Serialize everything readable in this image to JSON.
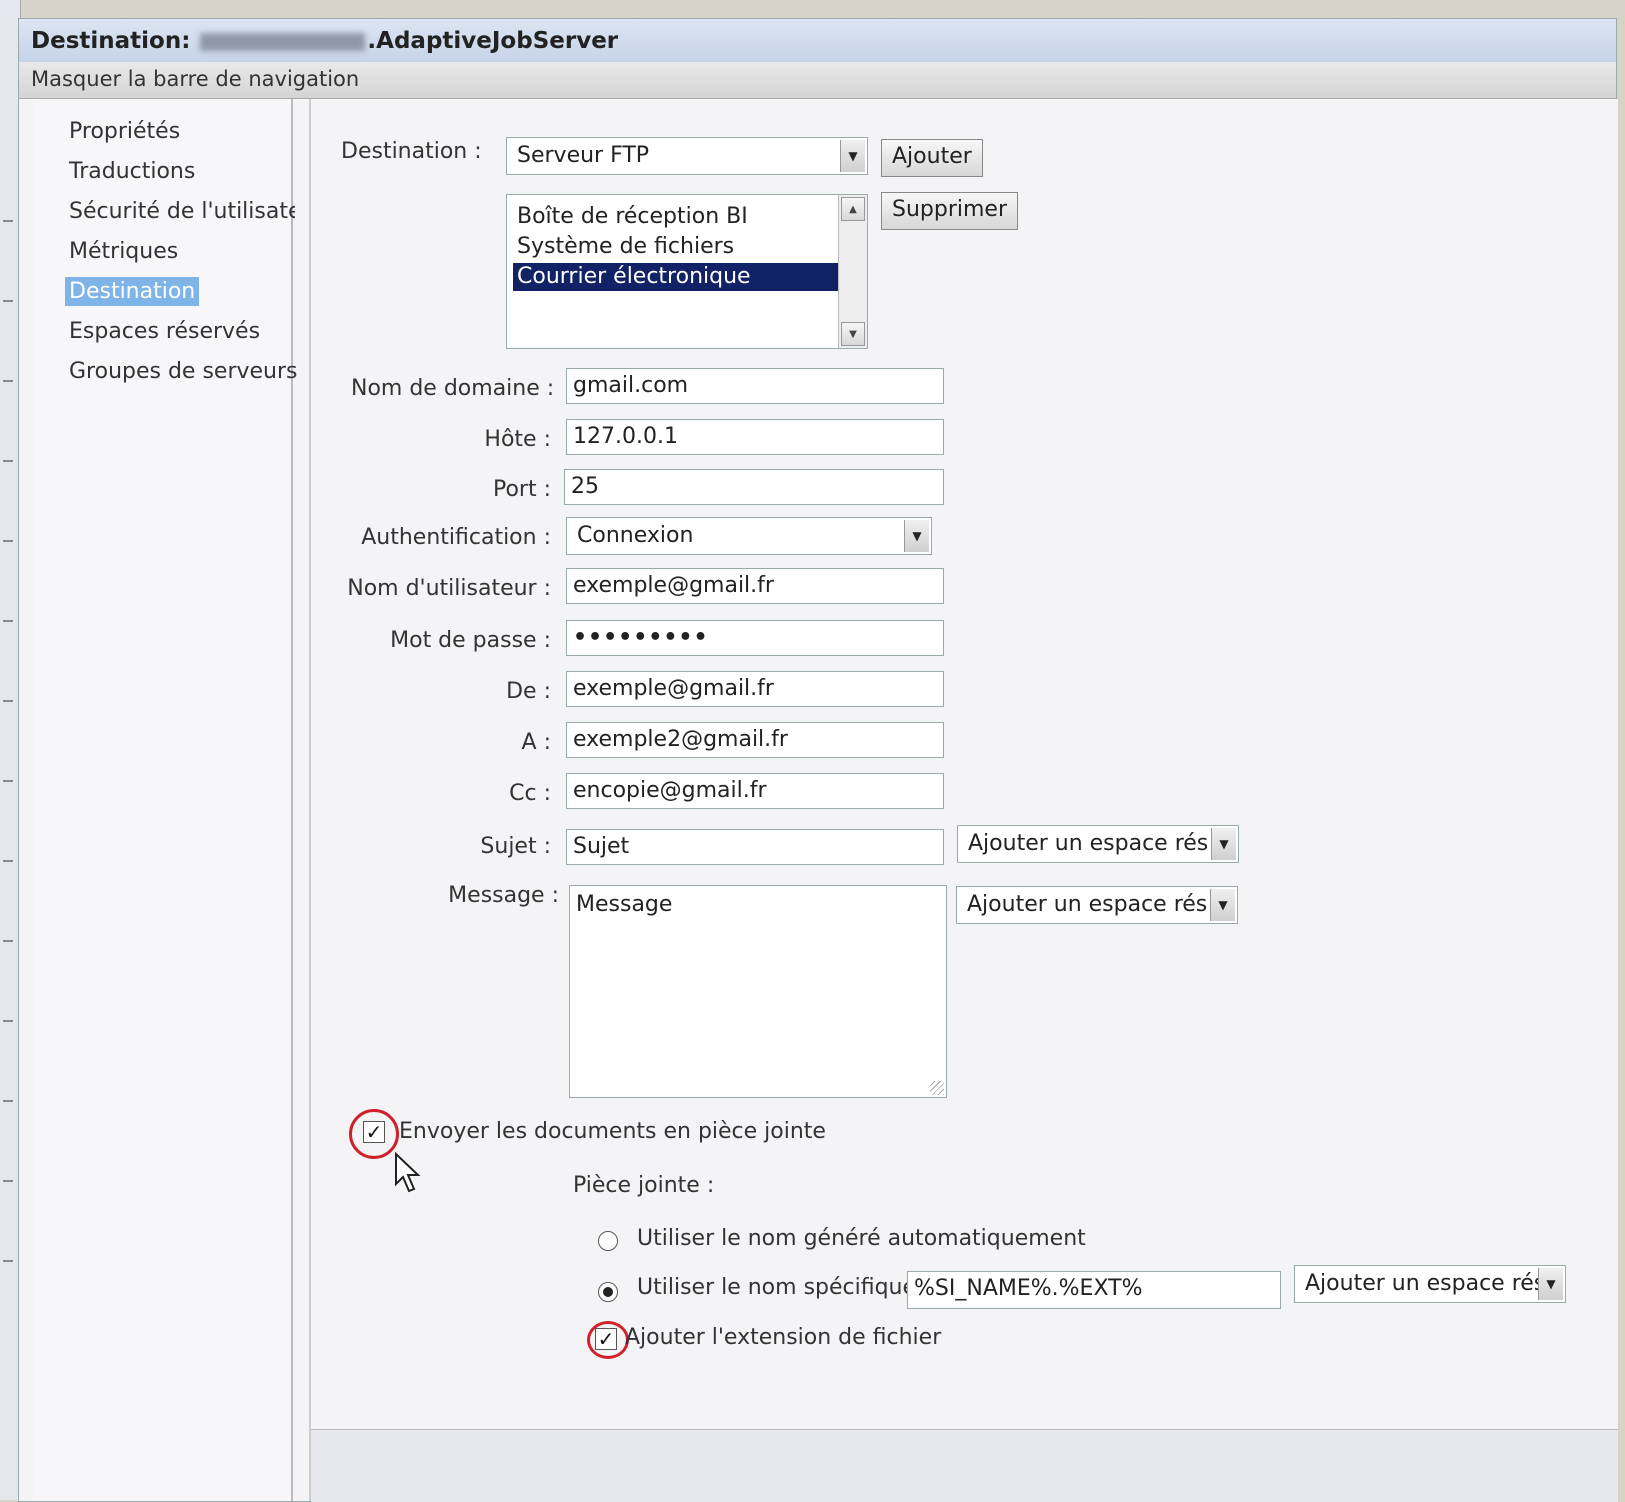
{
  "window": {
    "title_prefix": "Destination:",
    "title_suffix": ".AdaptiveJobServer",
    "navbar_toggle": "Masquer la barre de navigation"
  },
  "nav": {
    "items": [
      {
        "label": "Propriétés"
      },
      {
        "label": "Traductions"
      },
      {
        "label": "Sécurité de l'utilisateu"
      },
      {
        "label": "Métriques"
      },
      {
        "label": "Destination"
      },
      {
        "label": "Espaces réservés"
      },
      {
        "label": "Groupes de serveurs"
      }
    ],
    "active_index": 4
  },
  "destination": {
    "label": "Destination :",
    "selected": "Serveur FTP",
    "add_button": "Ajouter",
    "remove_button": "Supprimer",
    "list": [
      "Boîte de réception BI",
      "Système de fichiers",
      "Courrier électronique"
    ],
    "list_selected_index": 2
  },
  "form": {
    "domain": {
      "label": "Nom de domaine :",
      "value": "gmail.com"
    },
    "host": {
      "label": "Hôte :",
      "value": "127.0.0.1"
    },
    "port": {
      "label": "Port :",
      "value": "25"
    },
    "auth": {
      "label": "Authentification :",
      "value": "Connexion"
    },
    "username": {
      "label": "Nom d'utilisateur :",
      "value": "exemple@gmail.fr"
    },
    "password": {
      "label": "Mot de passe :",
      "value": "•••••••••"
    },
    "from": {
      "label": "De :",
      "value": "exemple@gmail.fr"
    },
    "to": {
      "label": "A :",
      "value": "exemple2@gmail.fr"
    },
    "cc": {
      "label": "Cc :",
      "value": "encopie@gmail.fr"
    },
    "subject": {
      "label": "Sujet :",
      "value": "Sujet",
      "placeholder_select": "Ajouter un espace rés"
    },
    "message": {
      "label": "Message :",
      "value": "Message",
      "placeholder_select": "Ajouter un espace rés"
    }
  },
  "attachment": {
    "send_as_attachment_label": "Envoyer les documents en pièce jointe",
    "send_as_attachment_checked": true,
    "section_label": "Pièce jointe :",
    "auto_name_label": "Utiliser le nom généré automatiquement",
    "specific_name_label": "Utiliser le nom spécifique",
    "specific_name_value": "%SI_NAME%.%EXT%",
    "specific_name_selected": true,
    "placeholder_select": "Ajouter un espace rés",
    "add_extension_label": "Ajouter l'extension de fichier",
    "add_extension_checked": true
  },
  "icons": {
    "dropdown": "chevron-down-icon",
    "check": "check-icon",
    "cursor": "mouse-pointer-icon"
  },
  "colors": {
    "title_bar": "#c6d4e8",
    "selection": "#112266",
    "active_nav": "#7fb4e8",
    "annotation": "#d0202a"
  }
}
